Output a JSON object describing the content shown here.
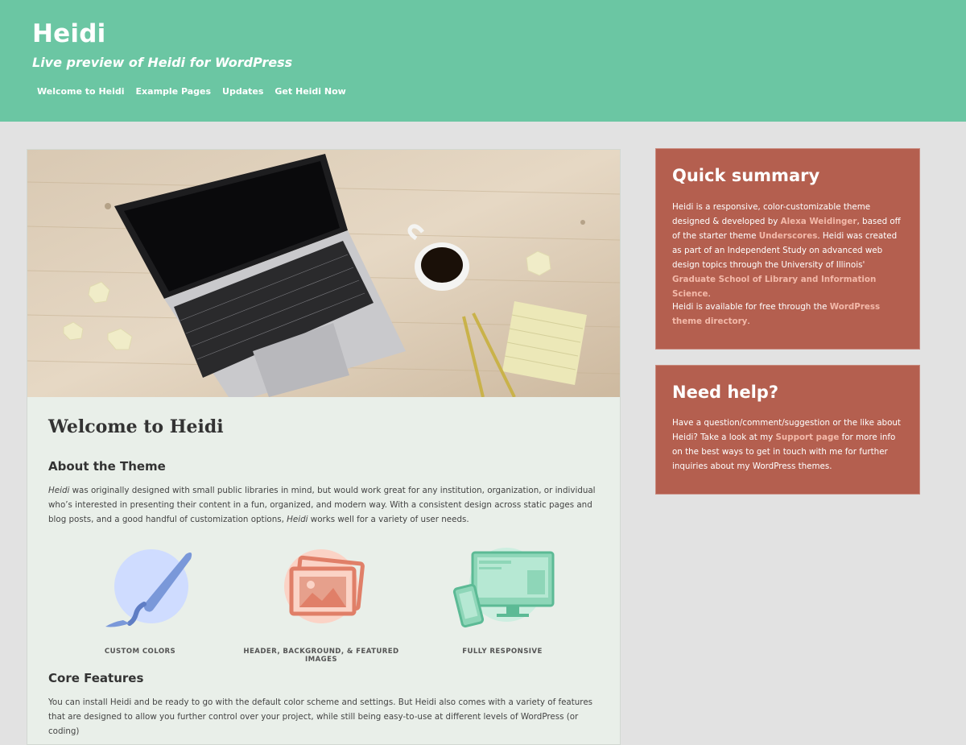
{
  "site": {
    "title": "Heidi",
    "description": "Live preview of Heidi for WordPress"
  },
  "nav": [
    {
      "label": "Welcome to Heidi"
    },
    {
      "label": "Example Pages"
    },
    {
      "label": "Updates"
    },
    {
      "label": "Get Heidi Now"
    }
  ],
  "page": {
    "title": "Welcome to Heidi",
    "about_heading": "About the Theme",
    "about_name": "Heidi",
    "about_text_1": " was originally designed with small public libraries in mind, but would work great for any institution, organization, or individual who’s interested in presenting their content in a fun, organized, and modern way. With a consistent design across static pages and blog posts, and a good handful of customization options, ",
    "about_name_2": "Heidi",
    "about_text_2": " works well for a variety of user needs.",
    "features": [
      {
        "label": "CUSTOM COLORS",
        "icon": "paintbrush-icon"
      },
      {
        "label": "HEADER, BACKGROUND, & FEATURED IMAGES",
        "icon": "images-icon"
      },
      {
        "label": "FULLY RESPONSIVE",
        "icon": "devices-icon"
      }
    ],
    "core_heading": "Core Features",
    "core_text": "You can install Heidi and be ready to go with the default color scheme and settings. But Heidi also comes with a variety of features that are designed to allow you further control over your project, while still being easy-to-use at different levels of WordPress (or coding)"
  },
  "sidebar": {
    "summary": {
      "title": "Quick summary",
      "p1_a": "Heidi is a responsive, color-customizable theme designed & developed by ",
      "author_link": "Alexa Weidinger",
      "p1_b": ", based off of the starter theme ",
      "underscores_link": "Underscores",
      "p1_c": ". Heidi was created as part of an Independent Study on advanced web design topics through the University of Illinois' ",
      "school_link": "Graduate School of Library and Information Science",
      "p1_d": ".",
      "p2_a": "Heidi is available for free through the ",
      "directory_link": "WordPress theme directory",
      "p2_b": "."
    },
    "help": {
      "title": "Need help?",
      "p_a": "Have a question/comment/suggestion or the like about Heidi? Take a look at my ",
      "support_link": "Support page",
      "p_b": " for more info on the best ways to get in touch with me for further inquiries about my WordPress themes."
    }
  },
  "colors": {
    "header_bg": "#6bc6a3",
    "page_bg": "#e2e2e2",
    "content_bg": "#e9efe9",
    "widget_bg": "#b45f4f",
    "widget_link": "#f3b9a9"
  }
}
